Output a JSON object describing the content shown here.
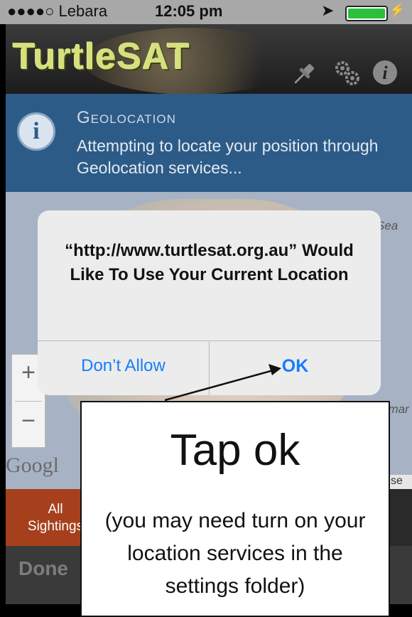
{
  "status_bar": {
    "carrier": "●●●●○ Lebara",
    "time": "12:05 pm"
  },
  "header": {
    "logo_part1": "Turtle",
    "logo_part2": "SAT"
  },
  "notice": {
    "title": "Geolocation",
    "message": "Attempting to locate your position through Geolocation services..."
  },
  "map": {
    "label_sea_top": "Sea",
    "label_sea_bottom": "smar",
    "google_label": "Googl",
    "terms_label": "Jse",
    "zoom_in": "+",
    "zoom_out": "−"
  },
  "bottom_tab": {
    "line1": "All",
    "line2": "Sightings"
  },
  "toolbar": {
    "done_label": "Done"
  },
  "alert": {
    "title": "“http://www.turtlesat.org.au” Would Like To Use Your Current Location",
    "deny_label": "Don’t Allow",
    "ok_label": "OK"
  },
  "callout": {
    "heading": "Tap ok",
    "note": "(you may need turn on your location services in the settings folder)"
  },
  "colors": {
    "notice_bg": "#2d5b88",
    "ios_blue": "#157efb",
    "tab_accent": "#a6401c"
  }
}
